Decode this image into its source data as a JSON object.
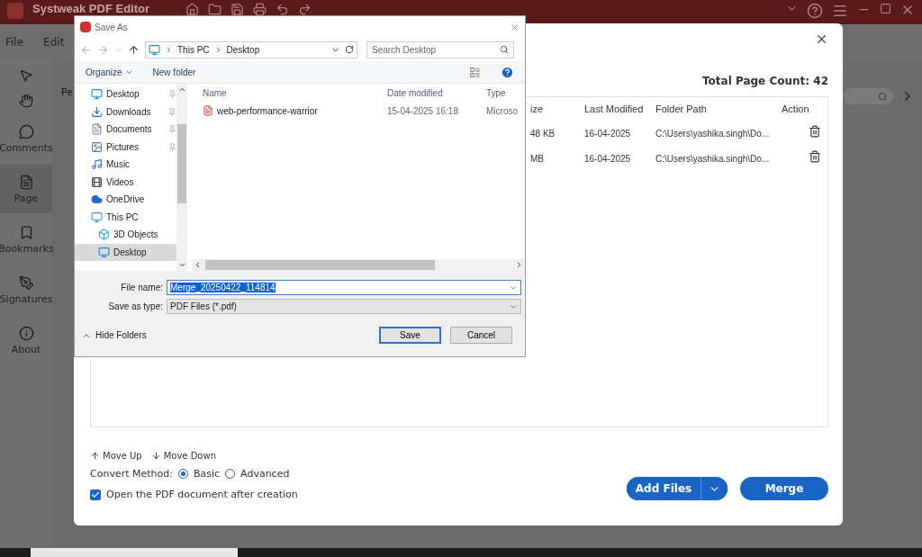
{
  "app": {
    "title": "Systweak PDF Editor",
    "menu": [
      "File",
      "Edit"
    ],
    "tools": [
      {
        "kind": "pointer"
      },
      {
        "kind": "hand"
      }
    ],
    "sidebar": [
      {
        "label": "Comments",
        "kind": "comments",
        "selected": false
      },
      {
        "label": "Page",
        "kind": "page",
        "selected": true
      },
      {
        "label": "Bookmarks",
        "kind": "bookmarks",
        "selected": false
      },
      {
        "label": "Signatures",
        "kind": "signatures",
        "selected": false
      },
      {
        "label": "About",
        "kind": "about",
        "selected": false
      }
    ],
    "tab_peek": "Pe"
  },
  "merge_dialog": {
    "total_page_count": "Total Page Count: 42",
    "columns": [
      "ize",
      "Last Modified",
      "Folder Path",
      "Action"
    ],
    "rows": [
      {
        "size": "48 KB",
        "modified": "16-04-2025",
        "path": "C:\\Users\\yashika.singh\\Do..."
      },
      {
        "size": "MB",
        "modified": "16-04-2025",
        "path": "C:\\Users\\yashika.singh\\Do..."
      }
    ],
    "move_up": "Move Up",
    "move_down": "Move Down",
    "convert_method": {
      "label": "Convert Method:",
      "options": [
        {
          "label": "Basic",
          "selected": true
        },
        {
          "label": "Advanced",
          "selected": false
        }
      ]
    },
    "open_after": {
      "label": "Open the PDF document after creation",
      "checked": true
    },
    "add_files": "Add Files",
    "merge": "Merge"
  },
  "save_dialog": {
    "title": "Save As",
    "path": [
      "This PC",
      "Desktop"
    ],
    "search": {
      "placeholder": "Search Desktop"
    },
    "toolbar": [
      "Organize",
      "New folder"
    ],
    "nav": [
      {
        "label": "Desktop",
        "kind": "desktop",
        "pinned": true,
        "selected": false
      },
      {
        "label": "Downloads",
        "kind": "downloads",
        "pinned": true,
        "selected": false
      },
      {
        "label": "Documents",
        "kind": "documents",
        "pinned": true,
        "selected": false
      },
      {
        "label": "Pictures",
        "kind": "pictures",
        "pinned": true,
        "selected": false
      },
      {
        "label": "Music",
        "kind": "music",
        "pinned": false,
        "selected": false
      },
      {
        "label": "Videos",
        "kind": "videos",
        "pinned": false,
        "selected": false
      },
      {
        "label": "OneDrive",
        "kind": "cloud",
        "pinned": false,
        "selected": false
      },
      {
        "label": "This PC",
        "kind": "computer",
        "pinned": false,
        "selected": false,
        "children": [
          {
            "label": "3D Objects",
            "kind": "cube",
            "pinned": false,
            "selected": false
          },
          {
            "label": "Desktop",
            "kind": "desktop",
            "pinned": false,
            "selected": true
          }
        ]
      }
    ],
    "columns": [
      "Name",
      "Date modified",
      "Type"
    ],
    "files": [
      {
        "name": "web-performance-warrior",
        "modified": "15-04-2025 16:18",
        "type": "Microso"
      }
    ],
    "file_name_label": "File name:",
    "file_name": "Merge_20250422_114814",
    "type_label": "Save as type:",
    "type_value": "PDF Files (*.pdf)",
    "hide_folders": "Hide Folders",
    "save": "Save",
    "cancel": "Cancel"
  }
}
